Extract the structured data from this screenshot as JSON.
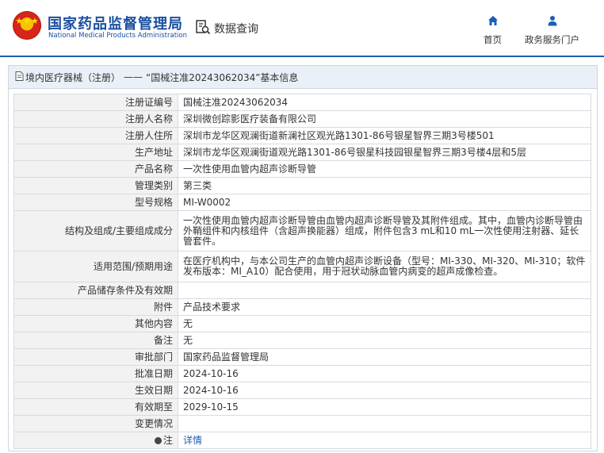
{
  "header": {
    "title_cn": "国家药品监督管理局",
    "title_en": "National Medical Products Administration",
    "search_label": "数据查询",
    "nav_home_label": "首页",
    "nav_service_label": "政务服务门户"
  },
  "breadcrumb": {
    "section": "境内医疗器械（注册）",
    "separator": "——",
    "current": "“国械注准20243062034”基本信息"
  },
  "rows": [
    {
      "label": "注册证编号",
      "value": "国械注准20243062034"
    },
    {
      "label": "注册人名称",
      "value": "深圳微创踪影医疗装备有限公司"
    },
    {
      "label": "注册人住所",
      "value": "深圳市龙华区观澜街道新澜社区观光路1301-86号银星智界三期3号楼501"
    },
    {
      "label": "生产地址",
      "value": "深圳市龙华区观澜街道观光路1301-86号银星科技园银星智界三期3号楼4层和5层"
    },
    {
      "label": "产品名称",
      "value": "一次性使用血管内超声诊断导管"
    },
    {
      "label": "管理类别",
      "value": "第三类"
    },
    {
      "label": "型号规格",
      "value": "MI-W0002"
    },
    {
      "label": "结构及组成/主要组成成分",
      "value": "一次性使用血管内超声诊断导管由血管内超声诊断导管及其附件组成。其中，血管内诊断导管由外鞘组件和内核组件（含超声换能器）组成，附件包含3 mL和10 mL一次性使用注射器、延长管套件。"
    },
    {
      "label": "适用范围/预期用途",
      "value": "在医疗机构中，与本公司生产的血管内超声诊断设备（型号：MI-330、MI-320、MI-310；软件发布版本：MI_A10）配合使用，用于冠状动脉血管内病变的超声成像检查。"
    },
    {
      "label": "产品储存条件及有效期",
      "value": ""
    },
    {
      "label": "附件",
      "value": "产品技术要求"
    },
    {
      "label": "其他内容",
      "value": "无"
    },
    {
      "label": "备注",
      "value": "无"
    },
    {
      "label": "审批部门",
      "value": "国家药品监督管理局"
    },
    {
      "label": "批准日期",
      "value": "2024-10-16"
    },
    {
      "label": "生效日期",
      "value": "2024-10-16"
    },
    {
      "label": "有效期至",
      "value": "2029-10-15"
    },
    {
      "label": "变更情况",
      "value": ""
    }
  ],
  "note_row": {
    "label": "注",
    "link_text": "详情"
  },
  "colors": {
    "brand_blue": "#1a4fa0",
    "accent_blue": "#1a5fb4",
    "emblem_red": "#d6251b"
  }
}
